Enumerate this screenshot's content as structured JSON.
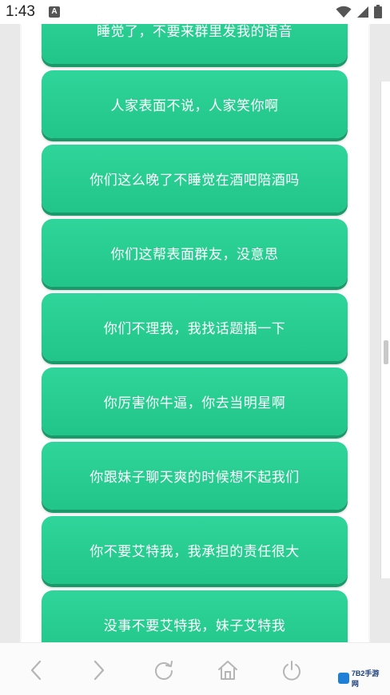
{
  "status_bar": {
    "time": "1:43",
    "app_icon_letter": "A"
  },
  "phrases": [
    "睡觉了，不要来群里发我的语音",
    "人家表面不说，人家笑你啊",
    "你们这么晚了不睡觉在酒吧陪酒吗",
    "你们这帮表面群友，没意思",
    "你们不理我，我找话题插一下",
    "你厉害你牛逼，你去当明星啊",
    "你跟妹子聊天爽的时候想不起我们",
    "你不要艾特我，我承担的责任很大",
    "没事不要艾特我，妹子艾特我"
  ],
  "bottom_nav": {
    "icons": [
      "back-icon",
      "forward-icon",
      "refresh-icon",
      "home-icon",
      "power-icon"
    ]
  },
  "watermark": {
    "text": "7B2手游网"
  },
  "colors": {
    "button_green": "#27cc90",
    "button_shadow": "#1a9a6b"
  }
}
